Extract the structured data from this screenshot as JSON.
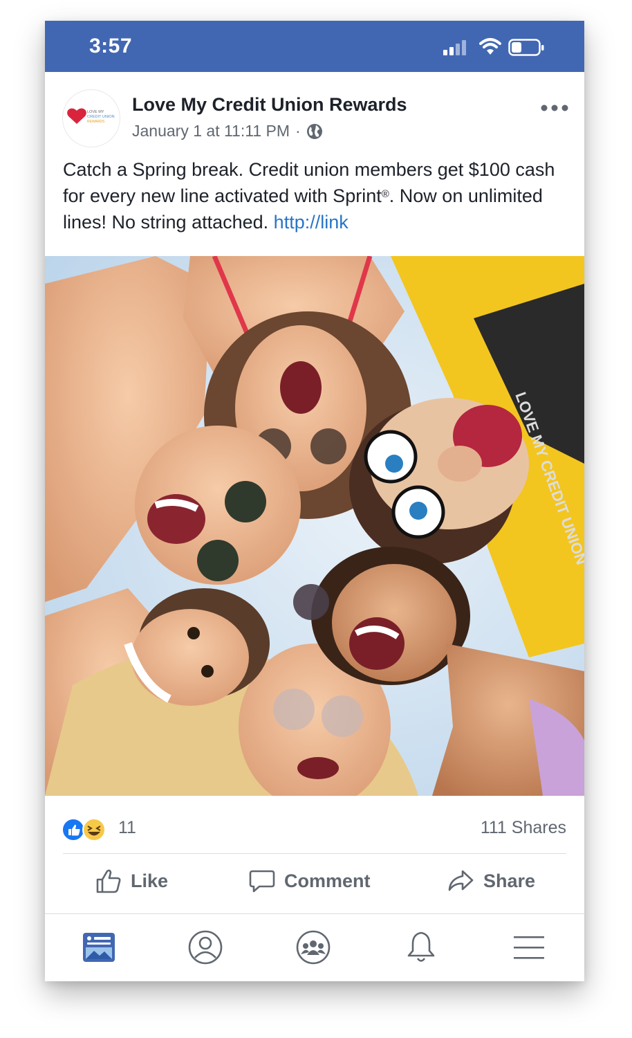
{
  "status_bar": {
    "time": "3:57",
    "background": "#4267b2",
    "icons": [
      "cellular-signal-icon",
      "wifi-icon",
      "battery-icon"
    ]
  },
  "post": {
    "page_name": "Love My Credit Union Rewards",
    "date": "January 1 at 11:11 PM",
    "separator": "·",
    "privacy_icon": "globe-icon",
    "more_icon": "more-options-icon",
    "text_part1": "Catch a Spring break. Credit union members get $100 cash for every new line activated with Sprint",
    "registered_mark": "®",
    "text_part2": ". Now on unlimited lines! No string attached. ",
    "link_text": "http://link",
    "avatar_logo": {
      "line1": "LOVE MY",
      "line2": "CREDIT UNION",
      "line3": "REWARDS",
      "heart_color": "#d9243d"
    },
    "photo_alt": "Group of friends and a puppet huddled in a circle looking down at the camera, laughing",
    "puppet_shirt_text": "LOVE MY CREDIT UNION"
  },
  "engagement": {
    "reaction_count": "11",
    "shares": "111 Shares",
    "reactions": [
      "like-reaction-icon",
      "haha-reaction-icon"
    ]
  },
  "actions": {
    "like": "Like",
    "comment": "Comment",
    "share": "Share"
  },
  "tabbar": {
    "items": [
      {
        "icon": "news-feed-icon",
        "active": true
      },
      {
        "icon": "profile-icon",
        "active": false
      },
      {
        "icon": "groups-icon",
        "active": false
      },
      {
        "icon": "notifications-bell-icon",
        "active": false
      },
      {
        "icon": "menu-icon",
        "active": false
      }
    ],
    "active_color": "#4267b2",
    "inactive_color": "#606770"
  }
}
